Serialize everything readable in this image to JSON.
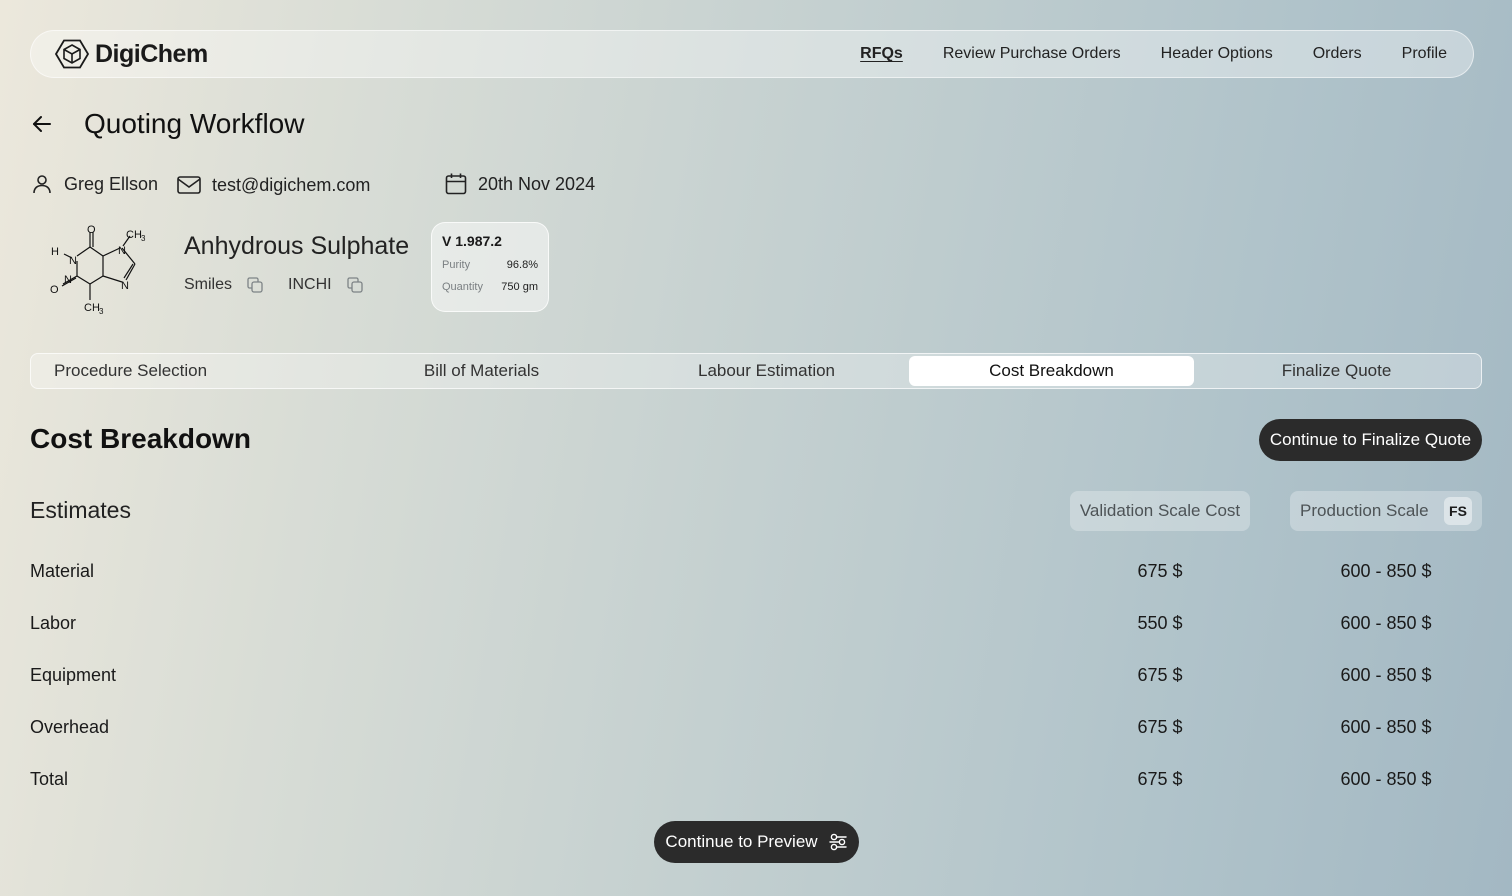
{
  "brand": {
    "name": "DigiChem",
    "logo_icon": "hexagon-cube-logo"
  },
  "nav": {
    "items": [
      {
        "label": "RFQs",
        "active": true
      },
      {
        "label": "Review Purchase Orders"
      },
      {
        "label": "Header Options"
      },
      {
        "label": "Orders"
      },
      {
        "label": "Profile"
      }
    ]
  },
  "header": {
    "title": "Quoting Workflow",
    "back_icon": "arrow-left-icon"
  },
  "meta": {
    "user": "Greg Ellson",
    "email": "test@digichem.com",
    "date": "20th Nov 2024"
  },
  "compound": {
    "name": "Anhydrous Sulphate",
    "smiles_label": "Smiles",
    "inchi_label": "INCHI",
    "structure_labels": {
      "o_top": "O",
      "ch3_top": "CH",
      "ch3_top_sub": "3",
      "h": "H",
      "n1": "N",
      "n2": "N",
      "n3": "N",
      "n4": "N",
      "o_left": "O",
      "ch3_bottom": "CH",
      "ch3_bottom_sub": "3"
    }
  },
  "version": {
    "title": "V 1.987.2",
    "purity_label": "Purity",
    "purity_value": "96.8%",
    "quantity_label": "Quantity",
    "quantity_value": "750 gm"
  },
  "tabs": [
    {
      "label": "Procedure Selection"
    },
    {
      "label": "Bill of Materials"
    },
    {
      "label": "Labour Estimation"
    },
    {
      "label": "Cost Breakdown",
      "active": true
    },
    {
      "label": "Finalize Quote"
    }
  ],
  "section": {
    "title": "Cost Breakdown",
    "continue_label": "Continue to Finalize Quote",
    "estimates_label": "Estimates",
    "validation_header": "Validation Scale Cost",
    "production_header": "Production Scale",
    "production_badge": "FS"
  },
  "rows": [
    {
      "label": "Material",
      "validation": "675 $",
      "production": "600 - 850 $"
    },
    {
      "label": "Labor",
      "validation": "550 $",
      "production": "600 - 850 $"
    },
    {
      "label": "Equipment",
      "validation": "675 $",
      "production": "600 - 850 $"
    },
    {
      "label": "Overhead",
      "validation": "675 $",
      "production": "600 - 850 $"
    },
    {
      "label": "Total",
      "validation": "675 $",
      "production": "600 - 850 $"
    }
  ],
  "footer": {
    "preview_label": "Continue to Preview"
  }
}
